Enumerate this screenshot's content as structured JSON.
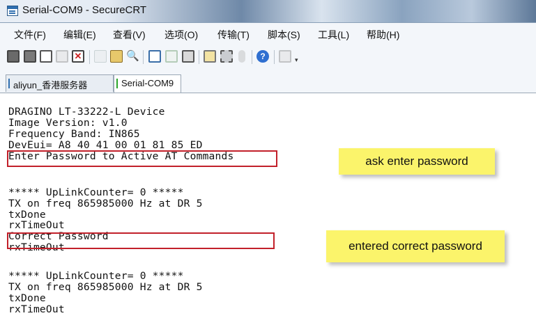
{
  "window": {
    "title": "Serial-COM9 - SecureCRT"
  },
  "menu": [
    "文件(F)",
    "编辑(E)",
    "查看(V)",
    "选项(O)",
    "传输(T)",
    "脚本(S)",
    "工具(L)",
    "帮助(H)"
  ],
  "toolbar": {
    "icons": [
      "connect-icon",
      "quick-connect-icon",
      "connect-in-tab-icon",
      "reconnect-icon",
      "disconnect-icon",
      "copy-icon",
      "paste-icon",
      "find-icon",
      "send-file-icon",
      "receive-file-icon",
      "print-icon",
      "session-options-icon",
      "global-options-icon",
      "key-icon",
      "help-icon",
      "map-keys-icon",
      "toolbar-overflow-icon"
    ]
  },
  "tabs": [
    {
      "label": "aliyun_香港服务器",
      "active": false
    },
    {
      "label": "Serial-COM9",
      "active": true
    }
  ],
  "terminal": {
    "lines": [
      "DRAGINO LT-33222-L Device",
      "Image Version: v1.0",
      "Frequency Band: IN865",
      "DevEui= A8 40 41 00 01 81 85 ED",
      "Enter Password to Active AT Commands",
      "",
      "",
      "***** UpLinkCounter= 0 *****",
      "TX on freq 865985000 Hz at DR 5",
      "txDone",
      "rxTimeOut",
      "Correct Password",
      "rxTimeOut",
      "",
      "***** UpLinkCounter= 0 *****",
      "TX on freq 865985000 Hz at DR 5",
      "txDone",
      "rxTimeOut"
    ]
  },
  "annotations": {
    "ask": "ask enter password",
    "correct": "entered correct password"
  },
  "colors": {
    "highlight_border": "#c2202a",
    "note_bg": "#fbf46b",
    "tab_marker_inactive": "#2f6fb0",
    "tab_marker_active": "#2aa52a"
  }
}
